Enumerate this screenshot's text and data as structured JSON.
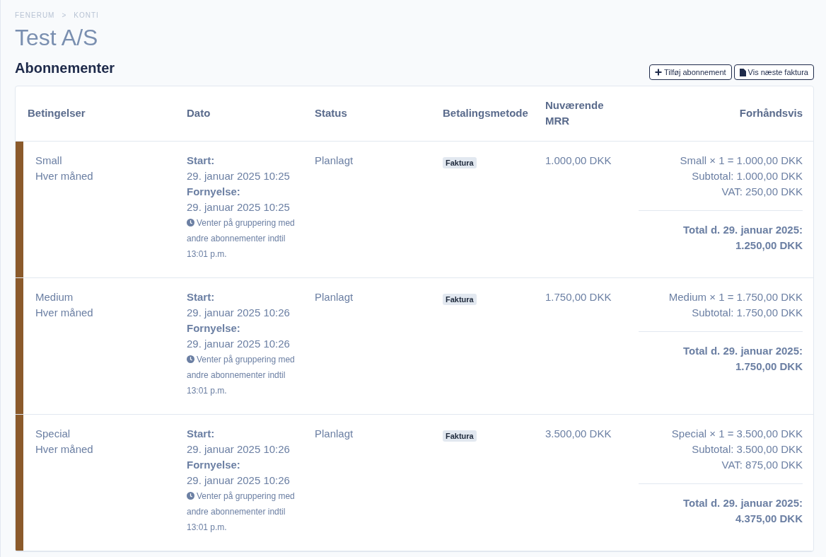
{
  "breadcrumb": [
    "FENERUM",
    ">",
    "KONTI"
  ],
  "title": "Test A/S",
  "section": {
    "heading": "Abonnementer",
    "buttons": [
      {
        "kind": "plus",
        "label": "Tilføj abonnement"
      },
      {
        "kind": "file",
        "label": "Vis næste faktura"
      }
    ]
  },
  "table": {
    "columns": [
      "Betingelser",
      "Dato",
      "Status",
      "Betalingsmetode",
      "Nuværende MRR",
      "Forhåndsvis"
    ],
    "rows": [
      {
        "color": "#8b5a2b",
        "plan": "Small",
        "interval": "Hver måned",
        "start_label": "Start:",
        "start": "29. januar 2025 10:25",
        "renewal_label": "Fornyelse:",
        "renewal": "29. januar 2025 10:25",
        "note": "Venter på gruppering med andre abonnementer indtil 13:01 p.m.",
        "status": "Planlagt",
        "payment": "Faktura",
        "mrr": "1.000,00 DKK",
        "preview": [
          "Small × 1 = 1.000,00 DKK",
          "Subtotal: 1.000,00 DKK",
          "VAT: 250,00 DKK"
        ],
        "total": "Total d. 29. januar 2025: 1.250,00 DKK"
      },
      {
        "color": "#8b5a2b",
        "plan": "Medium",
        "interval": "Hver måned",
        "start_label": "Start:",
        "start": "29. januar 2025 10:26",
        "renewal_label": "Fornyelse:",
        "renewal": "29. januar 2025 10:26",
        "note": "Venter på gruppering med andre abonnementer indtil 13:01 p.m.",
        "status": "Planlagt",
        "payment": "Faktura",
        "mrr": "1.750,00 DKK",
        "preview": [
          "Medium × 1 = 1.750,00 DKK",
          "Subtotal: 1.750,00 DKK"
        ],
        "total": "Total d. 29. januar 2025: 1.750,00 DKK"
      },
      {
        "color": "#8b5a2b",
        "plan": "Special",
        "interval": "Hver måned",
        "start_label": "Start:",
        "start": "29. januar 2025 10:26",
        "renewal_label": "Fornyelse:",
        "renewal": "29. januar 2025 10:26",
        "note": "Venter på gruppering med andre abonnementer indtil 13:01 p.m.",
        "status": "Planlagt",
        "payment": "Faktura",
        "mrr": "3.500,00 DKK",
        "preview": [
          "Special × 1 = 3.500,00 DKK",
          "Subtotal: 3.500,00 DKK",
          "VAT: 875,00 DKK"
        ],
        "total": "Total d. 29. januar 2025: 4.375,00 DKK"
      }
    ]
  }
}
